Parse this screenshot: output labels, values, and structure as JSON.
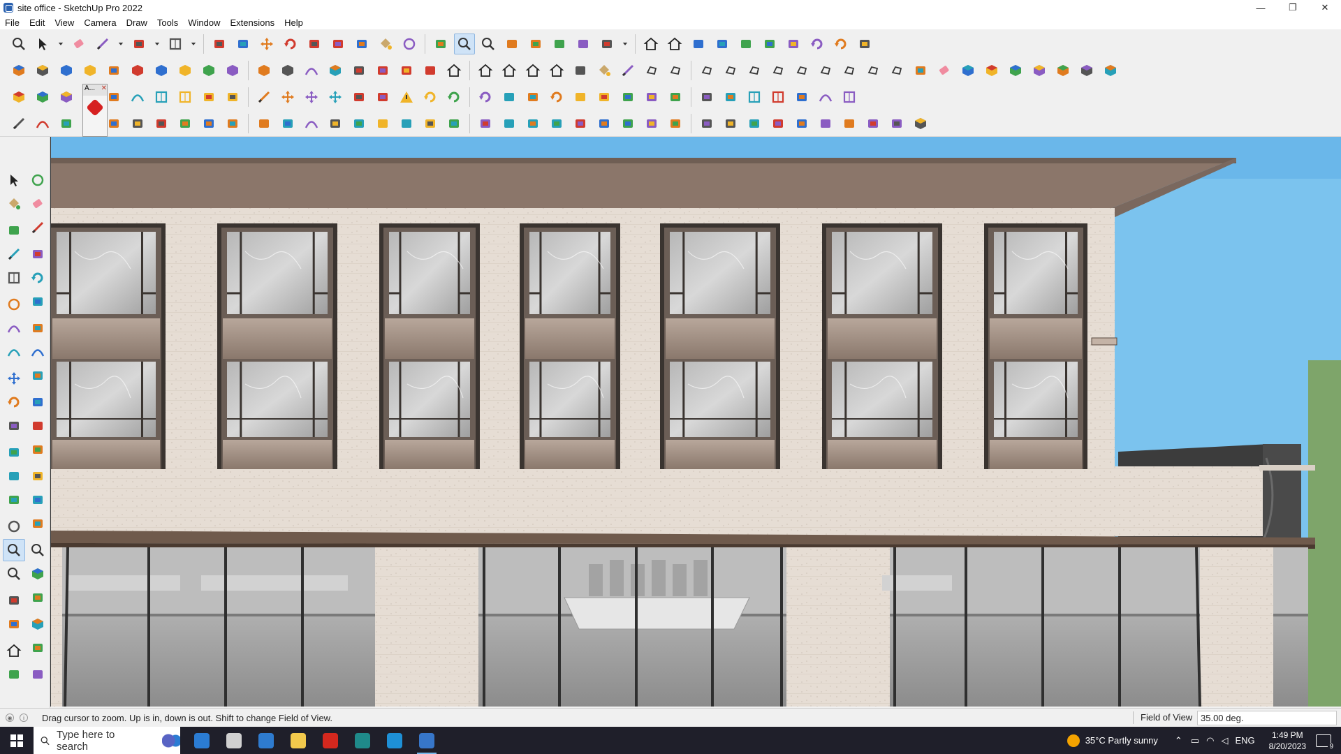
{
  "window": {
    "title": "site office - SketchUp Pro 2022",
    "controls": {
      "minimize": "—",
      "restore": "❐",
      "close": "✕"
    }
  },
  "menu": [
    "File",
    "Edit",
    "View",
    "Camera",
    "Draw",
    "Tools",
    "Window",
    "Extensions",
    "Help"
  ],
  "toolbar": {
    "popup_label": "A...",
    "row1": [
      "zoom-icon",
      "select-icon",
      "dropdown-icon",
      "eraser-icon",
      "pencil-line-icon",
      "dropdown-icon",
      "lasso-icon",
      "dropdown-icon",
      "rectangle-icon",
      "dropdown-icon",
      "push-pull-icon",
      "follow-me-icon",
      "move-icon",
      "rotate-icon",
      "scale-icon",
      "tape-measure-icon",
      "text-icon",
      "paint-bucket-icon",
      "orbit-icon",
      "pan-icon",
      "zoom-icon",
      "zoom-extents-icon",
      "components-icon",
      "materials-icon",
      "styles-icon",
      "layers-icon",
      "profile-icon",
      "dropdown-icon",
      "warehouse-icon",
      "extension-warehouse-icon",
      "send-to-layout-icon",
      "sandbox-from-contours-icon",
      "sandbox-smoove-icon",
      "sandbox-stamp-icon",
      "sandbox-drape-icon",
      "undo-icon",
      "redo-icon",
      "ruby-icon"
    ],
    "row2": [
      "iso-view-icon",
      "top-view-icon",
      "front-view-icon",
      "right-view-icon",
      "axes-icon",
      "view-x-icon",
      "view-y-icon",
      "view-z-icon",
      "view-n-icon",
      "view-e-icon",
      "view-s-icon",
      "view-w-icon",
      "arc-icon",
      "section-plane-icon",
      "section-cut-icon",
      "section-fill-icon",
      "solid-union-icon",
      "solid-trim-icon",
      "house-icon",
      "house-icon",
      "house-icon",
      "house-icon",
      "house-icon",
      "fx-icon",
      "paint-icon",
      "pencil-icon",
      "shape-icon",
      "shape-icon",
      "shape-icon",
      "shape-icon",
      "shape-icon",
      "shape-icon",
      "shape-icon",
      "shape-icon",
      "shape-icon",
      "shape-icon",
      "shape-icon",
      "tag-icon",
      "eraser-icon",
      "block-icon",
      "block-icon",
      "block-icon",
      "block-icon",
      "block-icon",
      "block-icon",
      "block-icon"
    ],
    "row3": [
      "plane-icon",
      "plane-icon",
      "plane-icon",
      "ruby-red-icon",
      "flip-icon",
      "curve-icon",
      "grid-icon",
      "window-icon",
      "chain-icon",
      "bend-icon",
      "spline-icon",
      "cross-icon",
      "add-icon",
      "cross-icon",
      "water-icon",
      "tent-icon",
      "warning-icon",
      "curl-icon",
      "curl-icon",
      "curl-icon",
      "arrows-icon",
      "box-icon",
      "undo-curve-icon",
      "puzzle-icon",
      "tools-icon",
      "tools-icon",
      "tools-icon",
      "gem-icon",
      "robot-icon",
      "panel-icon",
      "grid-icon",
      "grid-icon",
      "dots-icon",
      "bezier-icon",
      "frame-icon"
    ],
    "row4": [
      "line-tool-icon",
      "curve-tool-icon",
      "fire-icon",
      "rope-icon",
      "hook-icon",
      "loop-icon",
      "wheel-icon",
      "hexagon-icon",
      "bend-icon",
      "bracket-icon",
      "corner-icon",
      "measure-icon",
      "arc-icon",
      "wall-icon",
      "ramp-icon",
      "stairs-icon",
      "balustrade-icon",
      "hand-icon",
      "leaf-icon",
      "roof-icon",
      "stairs-icon",
      "slash-icon",
      "fork-icon",
      "fork-icon",
      "fork-icon",
      "brick-icon",
      "fence-icon",
      "chair-icon",
      "chair-icon",
      "rail-icon",
      "mesh-icon",
      "rail-icon",
      "rail-icon",
      "spring-icon",
      "spring-icon",
      "wave-icon",
      "fan-icon",
      "cube-icon"
    ]
  },
  "left_tools": [
    "select-icon",
    "orbit-icon",
    "paint-bucket-icon",
    "eraser-icon",
    "components-icon",
    "pencil-icon",
    "line-icon",
    "freehand-icon",
    "rectangle-icon",
    "rotated-rectangle-icon",
    "circle-icon",
    "polygon-icon",
    "arc-icon",
    "pie-icon",
    "arc3-icon",
    "curve-icon",
    "move-icon",
    "push-pull-icon",
    "rotate-icon",
    "follow-me-icon",
    "scale-icon",
    "offset-icon",
    "tape-measure-icon",
    "dimension-icon",
    "protractor-icon",
    "text-icon",
    "axes-icon",
    "3d-text-icon",
    "orbit-icon",
    "pan-icon",
    "zoom-icon",
    "zoom-window-icon",
    "zoom-extents-icon",
    "previous-view-icon",
    "position-camera-icon",
    "look-around-icon",
    "walk-icon",
    "section-plane-icon",
    "warehouse-icon",
    "sandbox-icon",
    "layers-icon",
    "styles-icon"
  ],
  "status": {
    "help_text": "Drag cursor to zoom.  Up is in, down is out. Shift to change Field of View.",
    "vcb_label": "Field of View",
    "vcb_value": "35.00 deg."
  },
  "taskbar": {
    "search_placeholder": "Type here to search",
    "apps": [
      "teams-icon",
      "task-view-icon",
      "calculator-icon",
      "file-explorer-icon",
      "acrobat-icon",
      "sway-icon",
      "edge-icon",
      "sketchup-icon"
    ],
    "weather": "35°C  Partly sunny",
    "language": "ENG",
    "time": "1:49 PM",
    "date": "8/20/2023",
    "notifications": "9"
  },
  "viewport": {
    "colors": {
      "sky": "#7bc3ee",
      "stone": "#e5dcd3",
      "roof_soffit": "#8b766a",
      "frame": "#3a3430",
      "glass": "#a8a8a8",
      "spandrel": "#a08e82",
      "dark_stone": "#3a3a3a"
    }
  }
}
